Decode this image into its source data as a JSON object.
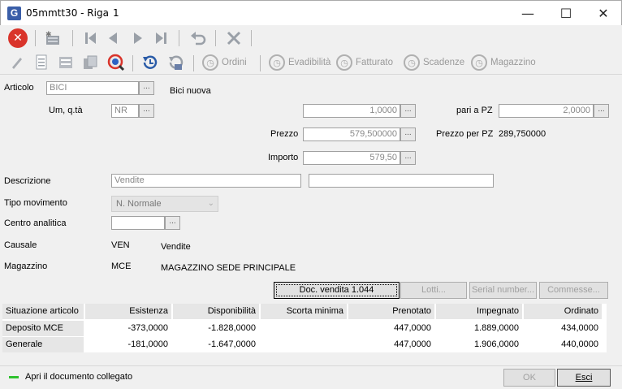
{
  "window": {
    "title": "05mmtt30 - Riga",
    "number": "1",
    "app_icon_letter": "G",
    "minimize_glyph": "—",
    "maximize_glyph": "☐",
    "close_glyph": "✕"
  },
  "toolbar2": {
    "ordini": "Ordini",
    "evadibilita": "Evadibilità",
    "fatturato": "Fatturato",
    "scadenze": "Scadenze",
    "magazzino": "Magazzino"
  },
  "form": {
    "articolo_label": "Articolo",
    "articolo_value": "BICI",
    "articolo_desc": "Bici nuova",
    "um_label": "Um, q.tà",
    "um_value": "NR",
    "qta_value": "1,0000",
    "pari_label": "pari a PZ",
    "pari_value": "2,0000",
    "prezzo_label": "Prezzo",
    "prezzo_value": "579,500000",
    "prezzo_pz_label": "Prezzo per PZ",
    "prezzo_pz_value": "289,750000",
    "importo_label": "Importo",
    "importo_value": "579,50",
    "descrizione_label": "Descrizione",
    "descrizione_value": "Vendite",
    "descrizione2_value": "",
    "tipo_label": "Tipo movimento",
    "tipo_value": "N. Normale",
    "centro_label": "Centro analitica",
    "centro_value": "",
    "causale_label": "Causale",
    "causale_code": "VEN",
    "causale_desc": "Vendite",
    "magazzino_label": "Magazzino",
    "magazzino_code": "MCE",
    "magazzino_desc": "MAGAZZINO SEDE PRINCIPALE",
    "dots": "..."
  },
  "buttons": {
    "doc_vendita": "Doc. vendita 1.044",
    "lotti": "Lotti...",
    "serial": "Serial number...",
    "commesse": "Commesse..."
  },
  "situazione": {
    "headers": [
      "Situazione articolo",
      "Esistenza",
      "Disponibilità",
      "Scorta minima",
      "Prenotato",
      "Impegnato",
      "Ordinato"
    ],
    "rows": [
      {
        "name": "Deposito MCE",
        "esistenza": "-373,0000",
        "disponibilita": "-1.828,0000",
        "scorta": "",
        "prenotato": "447,0000",
        "impegnato": "1.889,0000",
        "ordinato": "434,0000"
      },
      {
        "name": "Generale",
        "esistenza": "-181,0000",
        "disponibilita": "-1.647,0000",
        "scorta": "",
        "prenotato": "447,0000",
        "impegnato": "1.906,0000",
        "ordinato": "440,0000"
      }
    ]
  },
  "status": {
    "hint": "Apri il documento collegato",
    "ok": "OK",
    "esci": "Esci",
    "indicator_color": "#2fc22f"
  }
}
